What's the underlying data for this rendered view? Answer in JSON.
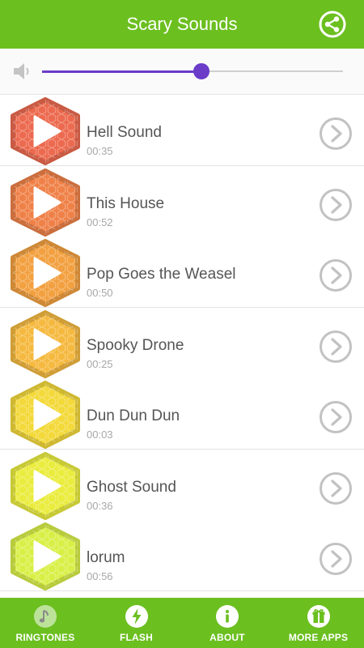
{
  "header": {
    "title": "Scary Sounds",
    "share_icon": "share-icon"
  },
  "volume": {
    "icon": "speaker-icon",
    "level": 0.53,
    "accent": "#6a3cc8"
  },
  "colors": {
    "primary": "#6bbf1f",
    "text": "#555555",
    "subtext": "#a8a8a8"
  },
  "sounds": [
    {
      "name": "Hell Sound",
      "duration": "00:35",
      "color": "#ec6a4f"
    },
    {
      "name": "This House",
      "duration": "00:52",
      "color": "#ef8148"
    },
    {
      "name": "Pop Goes the Weasel",
      "duration": "00:50",
      "color": "#f2a040"
    },
    {
      "name": "Spooky Drone",
      "duration": "00:25",
      "color": "#f5b93f"
    },
    {
      "name": "Dun Dun Dun",
      "duration": "00:03",
      "color": "#f3d93a"
    },
    {
      "name": "Ghost Sound",
      "duration": "00:36",
      "color": "#eaec3e"
    },
    {
      "name": "lorum",
      "duration": "00:56",
      "color": "#d9ef47"
    }
  ],
  "bottom_nav": [
    {
      "label": "RINGTONES",
      "icon": "music-note-icon"
    },
    {
      "label": "FLASH",
      "icon": "flash-icon"
    },
    {
      "label": "ABOUT",
      "icon": "info-icon"
    },
    {
      "label": "MORE APPS",
      "icon": "gift-icon"
    }
  ]
}
